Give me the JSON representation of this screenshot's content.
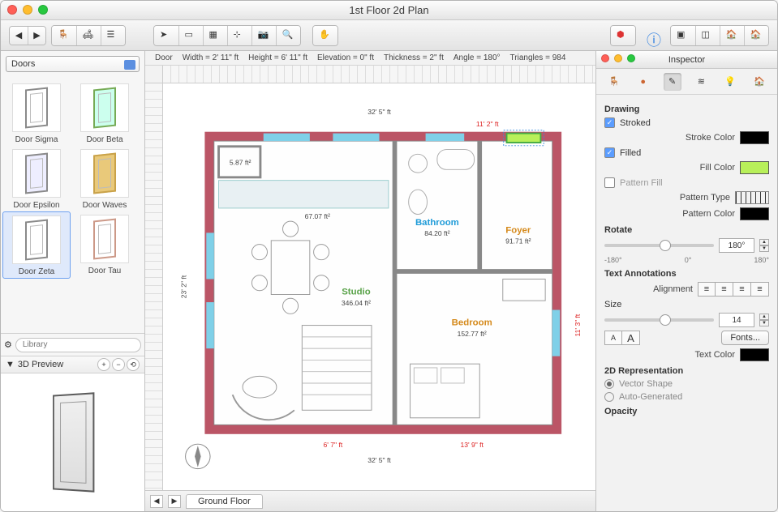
{
  "window": {
    "title": "1st Floor 2d Plan"
  },
  "status": {
    "object": "Door",
    "width_label": "Width",
    "width": "2' 11\" ft",
    "height_label": "Height",
    "height": "6' 11\" ft",
    "elevation_label": "Elevation",
    "elevation": "0\" ft",
    "thickness_label": "Thickness",
    "thickness": "2\" ft",
    "angle_label": "Angle",
    "angle": "180°",
    "triangles_label": "Triangles",
    "triangles": "984"
  },
  "library": {
    "category": "Doors",
    "items": [
      {
        "label": "Door Sigma"
      },
      {
        "label": "Door Beta"
      },
      {
        "label": "Door Epsilon"
      },
      {
        "label": "Door Waves"
      },
      {
        "label": "Door Zeta",
        "selected": true
      },
      {
        "label": "Door Tau"
      }
    ],
    "search_placeholder": "Library",
    "preview_label": "3D Preview"
  },
  "floors": {
    "active": "Ground Floor"
  },
  "plan": {
    "outer_w": "32' 5\" ft",
    "outer_h": "23' 2\" ft",
    "top_right": "11' 2\" ft",
    "right": "11' 3\" ft",
    "bottom_left": "6' 7\" ft",
    "bottom_right": "13' 9\" ft",
    "rooms": {
      "studio": {
        "name": "Studio",
        "area": "346.04 ft²",
        "color": "#5aa34a"
      },
      "bathroom": {
        "name": "Bathroom",
        "area": "84.20 ft²",
        "color": "#1f9bd8"
      },
      "foyer": {
        "name": "Foyer",
        "area": "91.71 ft²",
        "color": "#d58a1c"
      },
      "bedroom": {
        "name": "Bedroom",
        "area": "152.77 ft²",
        "color": "#d58a1c"
      }
    },
    "closet": {
      "area": "5.87 ft²"
    },
    "kitchen_area": "67.07 ft²"
  },
  "inspector": {
    "title": "Inspector",
    "drawing": "Drawing",
    "stroked": "Stroked",
    "stroke_color_label": "Stroke Color",
    "stroke_color": "#000000",
    "filled": "Filled",
    "fill_color_label": "Fill Color",
    "fill_color": "#b8f05a",
    "pattern_fill": "Pattern Fill",
    "pattern_type": "Pattern Type",
    "pattern_color": "Pattern Color",
    "pattern_color_val": "#000000",
    "rotate": "Rotate",
    "rotate_val": "180°",
    "rot_min": "-180°",
    "rot_zero": "0°",
    "rot_max": "180°",
    "text_ann": "Text Annotations",
    "alignment": "Alignment",
    "size": "Size",
    "size_val": "14",
    "fonts": "Fonts...",
    "text_color": "Text Color",
    "text_color_val": "#000000",
    "rep2d": "2D Representation",
    "vector_shape": "Vector Shape",
    "auto_gen": "Auto-Generated",
    "opacity": "Opacity"
  }
}
